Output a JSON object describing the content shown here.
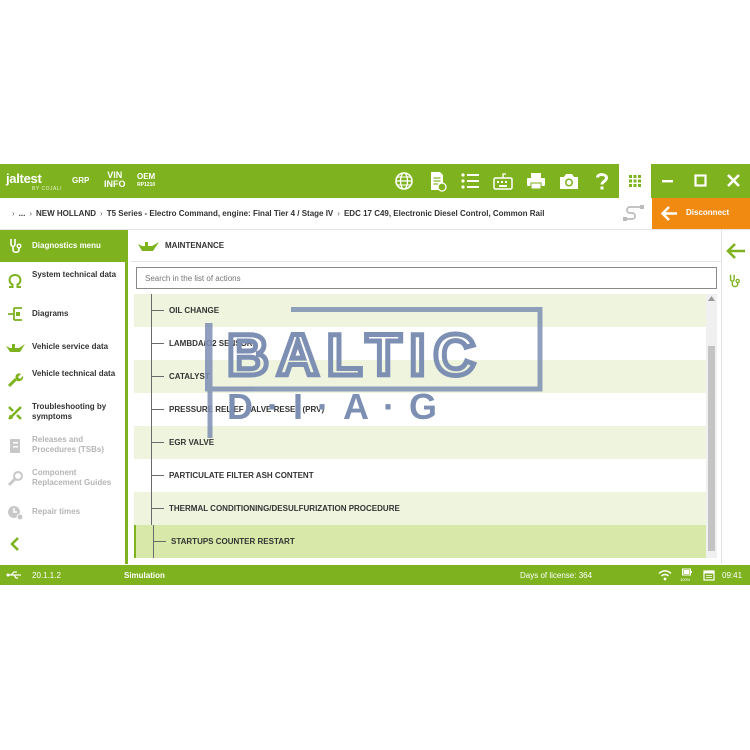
{
  "topbar": {
    "logo_brand": "jaltest",
    "logo_sub": "BY COJALI",
    "grp_label": "GRP",
    "vin_line1": "VIN",
    "vin_line2": "INFO",
    "oem_line1": "OEM",
    "oem_line2": "RP1210",
    "icons": [
      "globe-icon",
      "report-icon",
      "list-icon",
      "keyboard-icon",
      "printer-icon",
      "camera-icon",
      "help-icon"
    ],
    "window_controls": [
      "apps-grid-icon",
      "minimize-icon",
      "maximize-icon",
      "close-icon"
    ]
  },
  "breadcrumb": {
    "items": [
      "...",
      "NEW HOLLAND",
      "T5 Series - Electro Command, engine: Final Tier 4 / Stage IV",
      "EDC 17 C49, Electronic Diesel Control, Common Rail"
    ],
    "disconnect_label": "Disconnect"
  },
  "sidebar": {
    "header": "Diagnostics menu",
    "items": [
      {
        "label": "System technical data",
        "icon": "ohm-icon",
        "enabled": true
      },
      {
        "label": "Diagrams",
        "icon": "diagram-icon",
        "enabled": true
      },
      {
        "label": "Vehicle service data",
        "icon": "oil-can-icon",
        "enabled": true
      },
      {
        "label": "Vehicle technical data",
        "icon": "wrench-icon",
        "enabled": true
      },
      {
        "label": "Troubleshooting by symptoms",
        "icon": "troubleshoot-icon",
        "enabled": true
      },
      {
        "label": "Releases and Procedures (TSBs)",
        "icon": "tsb-icon",
        "enabled": false
      },
      {
        "label": "Component Replacement Guides",
        "icon": "component-icon",
        "enabled": false
      },
      {
        "label": "Repair times",
        "icon": "repair-time-icon",
        "enabled": false
      }
    ]
  },
  "main": {
    "section_title": "MAINTENANCE",
    "search_placeholder": "Search in the list of actions",
    "rows": [
      "OIL CHANGE",
      "LAMBDA/O2 SENSOR",
      "CATALYST",
      "PRESSURE RELIEF VALVE RESET (PRV)",
      "EGR VALVE",
      "PARTICULATE FILTER ASH CONTENT",
      "THERMAL CONDITIONING/DESULFURIZATION PROCEDURE",
      "STARTUPS COUNTER RESTART"
    ],
    "selected_row": 7
  },
  "status": {
    "version": "20.1.1.2",
    "mode": "Simulation",
    "license": "Days of license: 364",
    "battery": "100%",
    "time": "09:41"
  },
  "watermark": {
    "line1": "BALTIC",
    "line2": "D·I·A·G"
  },
  "colors": {
    "accent": "#7eb31f",
    "disconnect": "#f08a11",
    "row_alt": "#eef4de",
    "row_selected": "#d7e8a8",
    "watermark": "#7d8fb3"
  }
}
